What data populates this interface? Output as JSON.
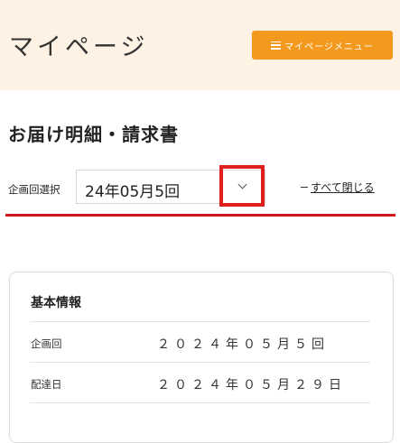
{
  "header": {
    "title": "マイページ",
    "menu_button_label": "マイページメニュー"
  },
  "section": {
    "title": "お届け明細・請求書"
  },
  "selector": {
    "label": "企画回選択",
    "value": "24年05月5回"
  },
  "close_all": {
    "label": "すべて閉じる"
  },
  "basic_info": {
    "title": "基本情報",
    "rows": [
      {
        "label": "企画回",
        "value": "２０２４年０５月５回"
      },
      {
        "label": "配達日",
        "value": "２０２４年０５月２９日"
      }
    ]
  },
  "colors": {
    "header_bg": "#fdf2e3",
    "menu_button": "#f39a1e",
    "highlight": "#e21f1f",
    "divider": "#d0161b"
  }
}
